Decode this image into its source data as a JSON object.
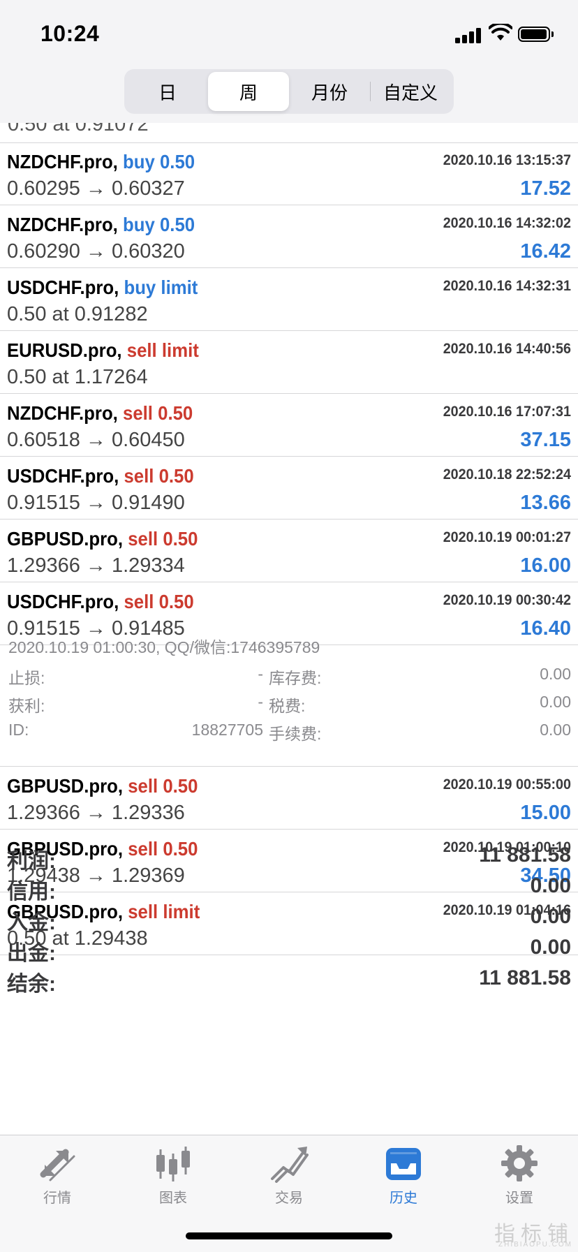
{
  "status_bar": {
    "time": "10:24"
  },
  "segments": [
    {
      "label": "日",
      "active": false
    },
    {
      "label": "周",
      "active": true
    },
    {
      "label": "月份",
      "active": false
    },
    {
      "label": "自定义",
      "active": false
    }
  ],
  "partial_text": "0.50 at 0.91072",
  "deals_top": [
    {
      "symbol": "NZDCHF.pro,",
      "action": "buy 0.50",
      "side": "buy",
      "date": "2020.10.16 13:15:37",
      "price": "0.60295 → 0.60327",
      "profit": "17.52"
    },
    {
      "symbol": "NZDCHF.pro,",
      "action": "buy 0.50",
      "side": "buy",
      "date": "2020.10.16 14:32:02",
      "price": "0.60290 → 0.60320",
      "profit": "16.42"
    },
    {
      "symbol": "USDCHF.pro,",
      "action": "buy limit",
      "side": "buy",
      "date": "2020.10.16 14:32:31",
      "price": "0.50 at 0.91282",
      "profit": ""
    },
    {
      "symbol": "EURUSD.pro,",
      "action": "sell limit",
      "side": "sell",
      "date": "2020.10.16 14:40:56",
      "price": "0.50 at 1.17264",
      "profit": ""
    },
    {
      "symbol": "NZDCHF.pro,",
      "action": "sell 0.50",
      "side": "sell",
      "date": "2020.10.16 17:07:31",
      "price": "0.60518 → 0.60450",
      "profit": "37.15"
    },
    {
      "symbol": "USDCHF.pro,",
      "action": "sell 0.50",
      "side": "sell",
      "date": "2020.10.18 22:52:24",
      "price": "0.91515 → 0.91490",
      "profit": "13.66"
    },
    {
      "symbol": "GBPUSD.pro,",
      "action": "sell 0.50",
      "side": "sell",
      "date": "2020.10.19 00:01:27",
      "price": "1.29366 → 1.29334",
      "profit": "16.00"
    },
    {
      "symbol": "USDCHF.pro,",
      "action": "sell 0.50",
      "side": "sell",
      "date": "2020.10.19 00:30:42",
      "price": "0.91515 → 0.91485",
      "profit": "16.40"
    }
  ],
  "detail": {
    "time_text": "2020.10.19 01:00:30, QQ/微信:1746395789",
    "lines": [
      {
        "label1": "止损:",
        "value1": "-",
        "label2": "库存费:",
        "value2": "0.00"
      },
      {
        "label1": "获利:",
        "value1": "-",
        "label2": "税费:",
        "value2": "0.00"
      },
      {
        "label1": "ID:",
        "value1": "18827705",
        "label2": "手续费:",
        "value2": "0.00"
      }
    ]
  },
  "deals_bottom": [
    {
      "symbol": "GBPUSD.pro,",
      "action": "sell 0.50",
      "side": "sell",
      "date": "2020.10.19 00:55:00",
      "price": "1.29366 → 1.29336",
      "profit": "15.00"
    },
    {
      "symbol": "GBPUSD.pro,",
      "action": "sell 0.50",
      "side": "sell",
      "date": "2020.10.19 01:00:10",
      "price": "1.29438 → 1.29369",
      "profit": "34.50"
    },
    {
      "symbol": "GBPUSD.pro,",
      "action": "sell limit",
      "side": "sell",
      "date": "2020.10.19 01:04:16",
      "price": "0.50 at 1.29438",
      "profit": ""
    }
  ],
  "summary": [
    {
      "label": "利润:",
      "value": "11 881.58"
    },
    {
      "label": "信用:",
      "value": "0.00"
    },
    {
      "label": "入金:",
      "value": "0.00"
    },
    {
      "label": "出金:",
      "value": "0.00"
    },
    {
      "label": "结余:",
      "value": "11 881.58"
    }
  ],
  "tabs": [
    {
      "label": "行情",
      "icon": "quotes-icon",
      "active": false
    },
    {
      "label": "图表",
      "icon": "chart-icon",
      "active": false
    },
    {
      "label": "交易",
      "icon": "trade-icon",
      "active": false
    },
    {
      "label": "历史",
      "icon": "history-icon",
      "active": true
    },
    {
      "label": "设置",
      "icon": "settings-icon",
      "active": false
    }
  ],
  "watermark": {
    "text": "指标铺",
    "sub": "ZHIBIAOPU.COM"
  },
  "colors": {
    "buy": "#2d7ad6",
    "sell": "#cc3b2f",
    "profit": "#2d7ad6",
    "active_tab": "#2d7ad6"
  }
}
